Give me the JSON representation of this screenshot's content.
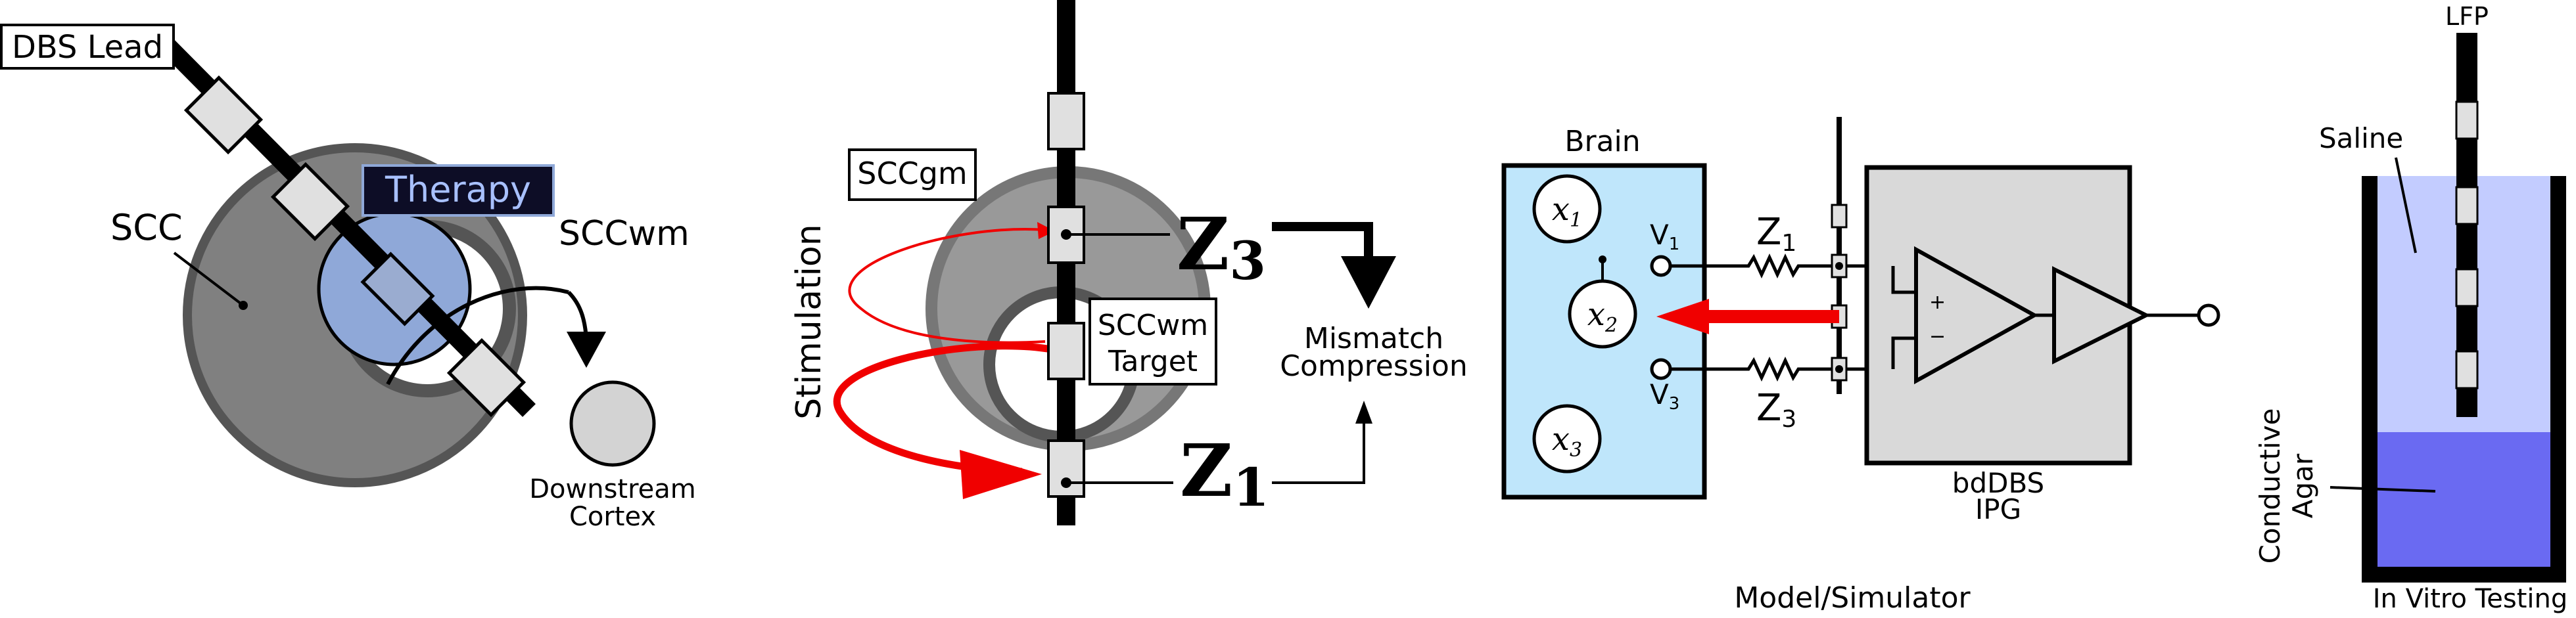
{
  "panel1": {
    "lead_label": "DBS Lead",
    "therapy_label": "Therapy",
    "scc_label": "SCC",
    "sccwm_label": "SCCwm",
    "downstream_line1": "Downstream",
    "downstream_line2": "Cortex"
  },
  "panel2": {
    "sccgm_label": "SCCgm",
    "sccwm_target_line1": "SCCwm",
    "sccwm_target_line2": "Target",
    "stimulation_label": "Stimulation",
    "z3_symbol": "Z",
    "z3_subscript": "3",
    "z1_symbol": "Z",
    "z1_subscript": "1",
    "mismatch_line1": "Mismatch",
    "mismatch_line2": "Compression"
  },
  "panel3": {
    "brain_label": "Brain",
    "x1": "x",
    "x1_sub": "1",
    "x2": "x",
    "x2_sub": "2",
    "x3": "x",
    "x3_sub": "3",
    "v1": "V",
    "v1_sub": "1",
    "v3": "V",
    "v3_sub": "3",
    "z1": "Z",
    "z1_sub": "1",
    "z3": "Z",
    "z3_sub": "3",
    "plus": "+",
    "minus": "−",
    "ipg_line1": "bdDBS",
    "ipg_line2": "IPG",
    "caption": "Model/Simulator"
  },
  "panel4": {
    "lfp_label": "LFP",
    "saline_label": "Saline",
    "agar_line1": "Conductive",
    "agar_line2": "Agar",
    "caption": "In Vitro Testing"
  },
  "colors": {
    "therapy_box": "#0d0d26",
    "therapy_text": "#a8c0ff",
    "therapy_region": "#8fa8d8",
    "brain_fill": "#bfe6fb",
    "saline": "#c3ccff",
    "agar": "#6a6af2",
    "stim_red": "#f00000",
    "gray_dark": "#808080",
    "gray_light": "#d3d3d3"
  }
}
